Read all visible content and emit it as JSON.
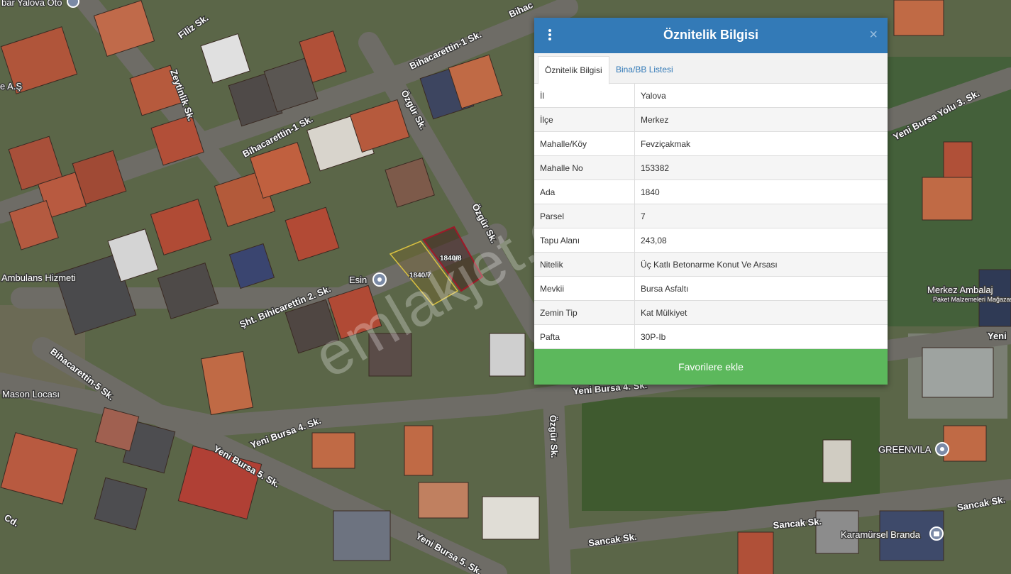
{
  "panel": {
    "title": "Öznitelik Bilgisi",
    "close": "×",
    "tabs": [
      "Öznitelik Bilgisi",
      "Bina/BB Listesi"
    ],
    "rows": [
      {
        "key": "İl",
        "value": "Yalova"
      },
      {
        "key": "İlçe",
        "value": "Merkez"
      },
      {
        "key": "Mahalle/Köy",
        "value": "Fevziçakmak"
      },
      {
        "key": "Mahalle No",
        "value": "153382"
      },
      {
        "key": "Ada",
        "value": "1840"
      },
      {
        "key": "Parsel",
        "value": "7"
      },
      {
        "key": "Tapu Alanı",
        "value": "243,08"
      },
      {
        "key": "Nitelik",
        "value": "Üç Katlı Betonarme Konut Ve Arsası"
      },
      {
        "key": "Mevkii",
        "value": "Bursa Asfaltı"
      },
      {
        "key": "Zemin Tip",
        "value": "Kat Mülkiyet"
      },
      {
        "key": "Pafta",
        "value": "30P-Ib"
      }
    ],
    "favorite_button": "Favorilere ekle"
  },
  "map": {
    "streets": [
      "Filiz Sk.",
      "Bihacarettin-1 Sk.",
      "Zeytinlik Sk.",
      "Bihacarettin-1 Sk.",
      "Özgür Sk.",
      "Özgür Sk.",
      "Şht. Bihicarettin 2. Sk.",
      "Bihacarettin-5 Sk.",
      "Yeni Bursa 4. Sk.",
      "Yeni Bursa 5. Sk.",
      "Yeni Bursa 5. Sk.",
      "Yeni Bursa 4. Sk.",
      "Özgür Sk.",
      "Sancak Sk.",
      "Sancak Sk.",
      "Sancak Sk.",
      "Yeni Bursa Yolu 3. Sk.",
      "Bihac",
      "Yeni",
      "Cd."
    ],
    "places": [
      "Ambulans Hizmeti",
      "Esin",
      "Mason Locası",
      "Merkez Ambalaj",
      "Paket Malzemeleri Mağazası",
      "GREENVILA",
      "Karamürsel Branda",
      "bar Yalova Oto",
      "e A.Ş"
    ],
    "parcels": [
      "1840/7",
      "1840/8"
    ],
    "watermark": "emlakjet.com"
  }
}
